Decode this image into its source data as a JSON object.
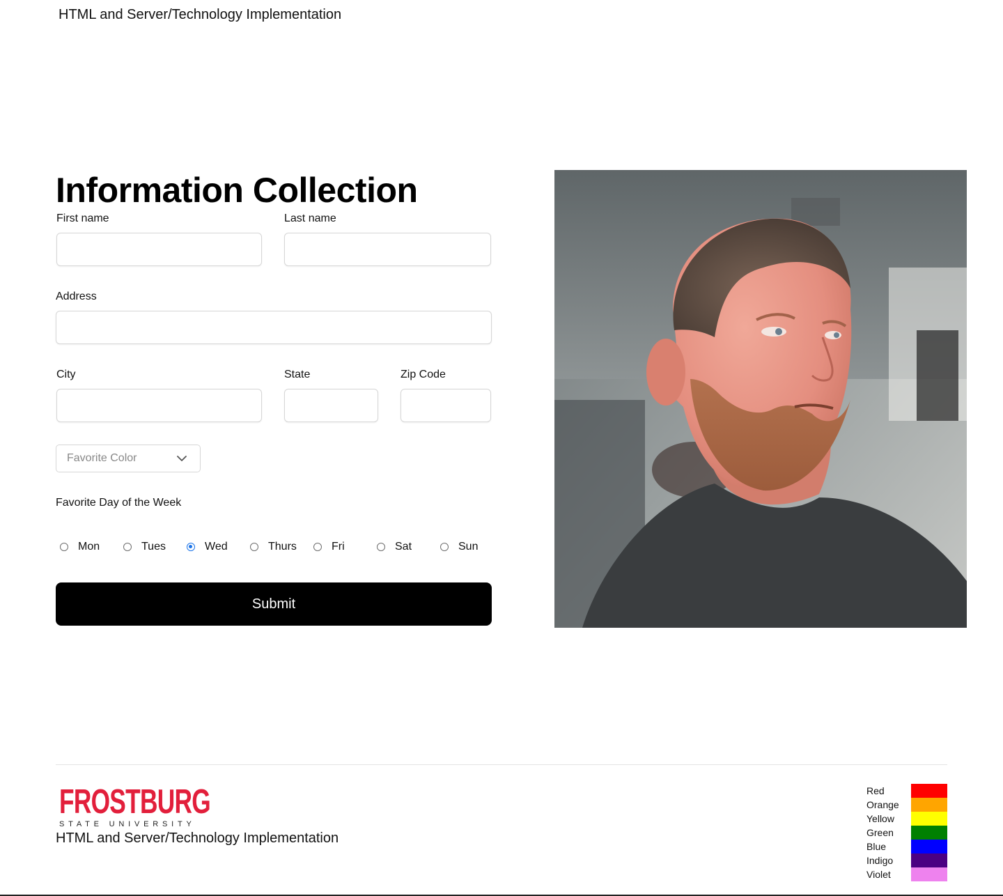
{
  "header": {
    "title": "HTML and Server/Technology Implementation"
  },
  "form": {
    "heading": "Information Collection",
    "first_name_label": "First name",
    "last_name_label": "Last name",
    "address_label": "Address",
    "city_label": "City",
    "state_label": "State",
    "zip_label": "Zip Code",
    "first_name_value": "",
    "last_name_value": "",
    "address_value": "",
    "city_value": "",
    "state_value": "",
    "zip_value": "",
    "favorite_color_select": {
      "placeholder": "Favorite Color"
    },
    "favorite_day_label": "Favorite Day of the Week",
    "days": [
      "Mon",
      "Tues",
      "Wed",
      "Thurs",
      "Fri",
      "Sat",
      "Sun"
    ],
    "selected_day": "Wed",
    "submit_label": "Submit"
  },
  "footer": {
    "logo_text": "FROSTBURG",
    "logo_subtext": "STATE UNIVERSITY",
    "title": "HTML and Server/Technology Implementation",
    "color_legend": [
      {
        "label": "Red",
        "color": "#ff0000"
      },
      {
        "label": "Orange",
        "color": "#ffa500"
      },
      {
        "label": "Yellow",
        "color": "#ffff00"
      },
      {
        "label": "Green",
        "color": "#008000"
      },
      {
        "label": "Blue",
        "color": "#0000ff"
      },
      {
        "label": "Indigo",
        "color": "#4b0082"
      },
      {
        "label": "Violet",
        "color": "#ee82ee"
      }
    ]
  },
  "colors": {
    "radio_accent": "#1a73e8",
    "logo_red": "#e21f3b",
    "button_bg": "#000000"
  }
}
